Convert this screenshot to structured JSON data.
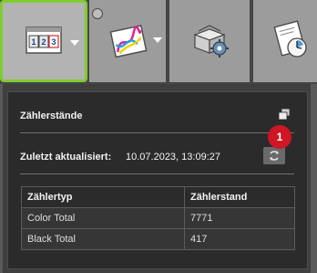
{
  "toolbar": {
    "buttons": [
      {
        "icon": "counter-icon",
        "has_dropdown": true,
        "active": true
      },
      {
        "icon": "color-chart-icon",
        "has_dropdown": true,
        "active": false
      },
      {
        "icon": "package-settings-icon",
        "has_dropdown": false,
        "active": false
      },
      {
        "icon": "document-clock-icon",
        "has_dropdown": false,
        "active": false
      }
    ],
    "counter_digits": [
      "1",
      "2",
      "3"
    ],
    "accent_color": "#7fcc2f"
  },
  "panel": {
    "title": "Zählerstände",
    "updated_label": "Zuletzt aktualisiert:",
    "updated_value": "10.07.2023, 13:09:27",
    "badge": "1",
    "badge_color": "#cf1624"
  },
  "table": {
    "headers": [
      "Zählertyp",
      "Zählerstand"
    ],
    "rows": [
      [
        "Color Total",
        "7771"
      ],
      [
        "Black Total",
        "417"
      ]
    ]
  }
}
